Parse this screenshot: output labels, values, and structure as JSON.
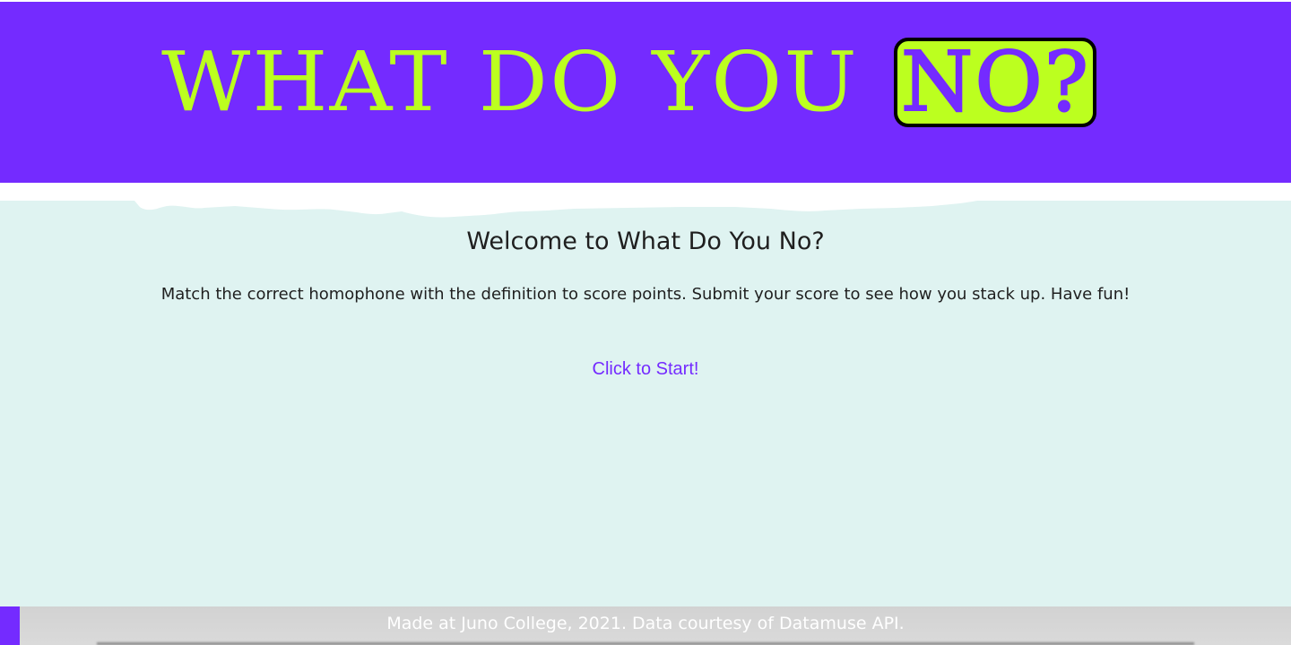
{
  "header": {
    "title_main": "WHAT DO YOU",
    "title_badge": "NO?"
  },
  "main": {
    "welcome_heading": "Welcome to What Do You No?",
    "instructions": "Match the correct homophone with the definition to score points. Submit your score to see how you stack up. Have fun!",
    "start_label": "Click to Start!"
  },
  "footer": {
    "credit": "Made at Juno College, 2021. Data courtesy of Datamuse API."
  },
  "colors": {
    "brand_purple": "#742bff",
    "brand_lime": "#bcff1f",
    "main_background": "#dff3f1",
    "footer_background": "#d2d2d2"
  }
}
